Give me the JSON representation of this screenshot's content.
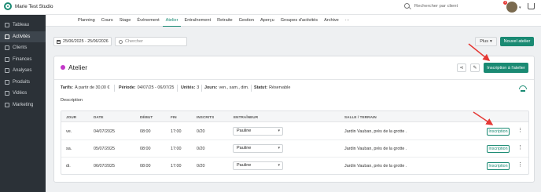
{
  "header": {
    "studio_name": "Marie Test Studio",
    "search_placeholder": "Rechercher par client",
    "notification_count": "1"
  },
  "nav": {
    "tabs": [
      {
        "label": "Planning"
      },
      {
        "label": "Cours"
      },
      {
        "label": "Stage"
      },
      {
        "label": "Événement"
      },
      {
        "label": "Atelier",
        "active": true
      },
      {
        "label": "Entraînement"
      },
      {
        "label": "Retraite"
      },
      {
        "label": "Gestion"
      },
      {
        "label": "Aperçu"
      },
      {
        "label": "Groupes d'activités"
      },
      {
        "label": "Archive"
      },
      {
        "label": "···"
      }
    ]
  },
  "sidebar": {
    "items": [
      {
        "label": "Tableau"
      },
      {
        "label": "Activités",
        "active": true
      },
      {
        "label": "Clients"
      },
      {
        "label": "Finances"
      },
      {
        "label": "Analyses"
      },
      {
        "label": "Produits"
      },
      {
        "label": "Vidéos"
      },
      {
        "label": "Marketing"
      }
    ]
  },
  "toolbar": {
    "date_range": "25/06/2025 - 25/06/2026",
    "filter_placeholder": "Chercher",
    "more_label": "Plus",
    "new_label": "Nouvel atelier"
  },
  "atelier": {
    "title": "Atelier",
    "color": "#c238c8",
    "register_label": "Inscription à l'atelier",
    "meta": {
      "tarifs_label": "Tarifs:",
      "tarifs_value": "À partir de 30,00 €",
      "periode_label": "Période:",
      "periode_value": "04/07/25 - 06/07/25",
      "unites_label": "Unités:",
      "unites_value": "3",
      "jours_label": "Jours:",
      "jours_value": "ven., sam., dim.",
      "statut_label": "Statut:",
      "statut_value": "Réservable"
    },
    "description_label": "Description"
  },
  "table": {
    "headers": {
      "jour": "JOUR",
      "date": "DATE",
      "debut": "DÉBUT",
      "fin": "FIN",
      "inscrits": "INSCRITS",
      "entraineur": "ENTRAÎNEUR",
      "salle": "SALLE / TERRAIN"
    },
    "rows": [
      {
        "jour": "ve.",
        "date": "04/07/2025",
        "debut": "08:00",
        "fin": "17:00",
        "inscrits": "0/20",
        "entraineur": "Pauline",
        "salle": "Jardin Vauban, près de la grotte .",
        "button": "Inscription"
      },
      {
        "jour": "sa.",
        "date": "05/07/2025",
        "debut": "08:00",
        "fin": "17:00",
        "inscrits": "0/20",
        "entraineur": "Pauline",
        "salle": "Jardin Vauban, près de la grotte .",
        "button": "Inscription"
      },
      {
        "jour": "di.",
        "date": "06/07/2025",
        "debut": "08:00",
        "fin": "17:00",
        "inscrits": "0/20",
        "entraineur": "Pauline",
        "salle": "Jardin Vauban, près de la grotte .",
        "button": "Inscription"
      }
    ]
  },
  "colors": {
    "brand": "#1a8a73",
    "sidebar": "#2b3137",
    "arrow": "#e53935"
  }
}
